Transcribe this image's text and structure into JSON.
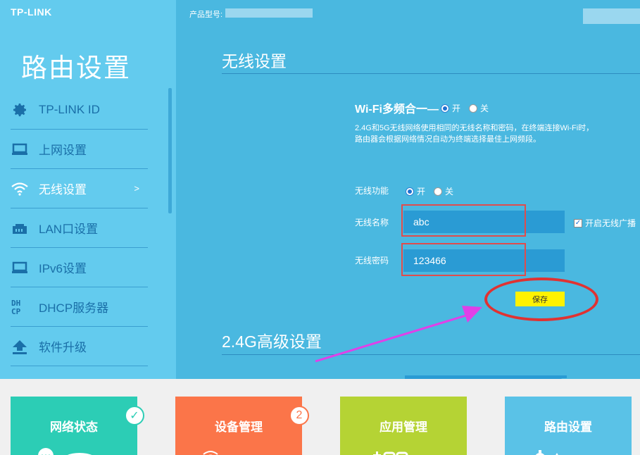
{
  "brand": {
    "logo": "TP-LINK"
  },
  "header": {
    "model_label": "产品型号:"
  },
  "sidebar": {
    "title": "路由设置",
    "items": [
      {
        "label": "TP-LINK ID",
        "icon": "gear-icon"
      },
      {
        "label": "上网设置",
        "icon": "laptop-icon"
      },
      {
        "label": "无线设置",
        "icon": "wifi-icon",
        "active": true,
        "arrow": ">"
      },
      {
        "label": "LAN口设置",
        "icon": "lan-port-icon"
      },
      {
        "label": "IPv6设置",
        "icon": "laptop-icon"
      },
      {
        "label": "DHCP服务器",
        "icon": "dhcp-icon"
      },
      {
        "label": "软件升级",
        "icon": "upload-icon"
      }
    ]
  },
  "main": {
    "section_title": "无线设置",
    "wifi_multi": {
      "label": "Wi-Fi多频合一",
      "on_label": "开",
      "off_label": "关",
      "selected": "on",
      "desc_line1": "2.4G和5G无线网络使用相同的无线名称和密码，在终端连接Wi-Fi时，",
      "desc_line2": "路由器会根据网络情况自动为终端选择最佳上网频段。"
    },
    "wireless_function": {
      "label": "无线功能",
      "on_label": "开",
      "off_label": "关",
      "selected": "on"
    },
    "ssid": {
      "label": "无线名称",
      "value": "abc"
    },
    "password": {
      "label": "无线密码",
      "value": "123466"
    },
    "broadcast": {
      "label": "开启无线广播",
      "checked": true
    },
    "save_label": "保存",
    "advanced_title": "2.4G高级设置"
  },
  "bottom_tabs": [
    {
      "label": "网络状态",
      "color": "#2ccdb5",
      "badge": "✓"
    },
    {
      "label": "设备管理",
      "color": "#fb7549",
      "badge": "2"
    },
    {
      "label": "应用管理",
      "color": "#b5d334"
    },
    {
      "label": "路由设置",
      "color": "#5ac2e7"
    }
  ],
  "colors": {
    "sidebar_bg": "#63cbee",
    "main_bg": "#4ab8e0",
    "highlight_red": "#e03232",
    "arrow_magenta": "#e040e8",
    "save_yellow": "#fff200"
  }
}
